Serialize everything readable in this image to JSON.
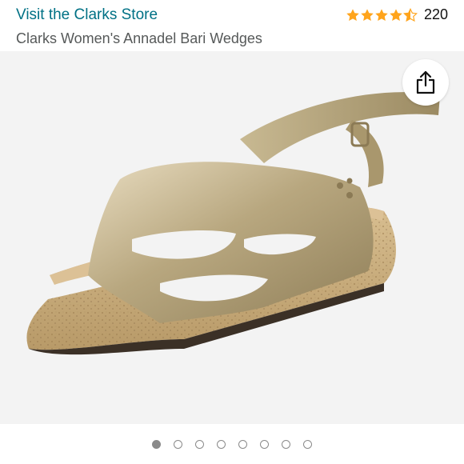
{
  "header": {
    "store_link": "Visit the Clarks Store",
    "title": "Clarks Women's Annadel Bari Wedges",
    "rating": {
      "stars": 4.5,
      "count": "220"
    }
  },
  "gallery": {
    "image_icon": "sandal-wedge-image",
    "share_icon": "share-icon",
    "page_count": 8,
    "active_index": 0
  },
  "colors": {
    "link": "#007185",
    "star": "#FFA41C",
    "title": "#565959",
    "gallery_bg": "#f3f3f3"
  }
}
